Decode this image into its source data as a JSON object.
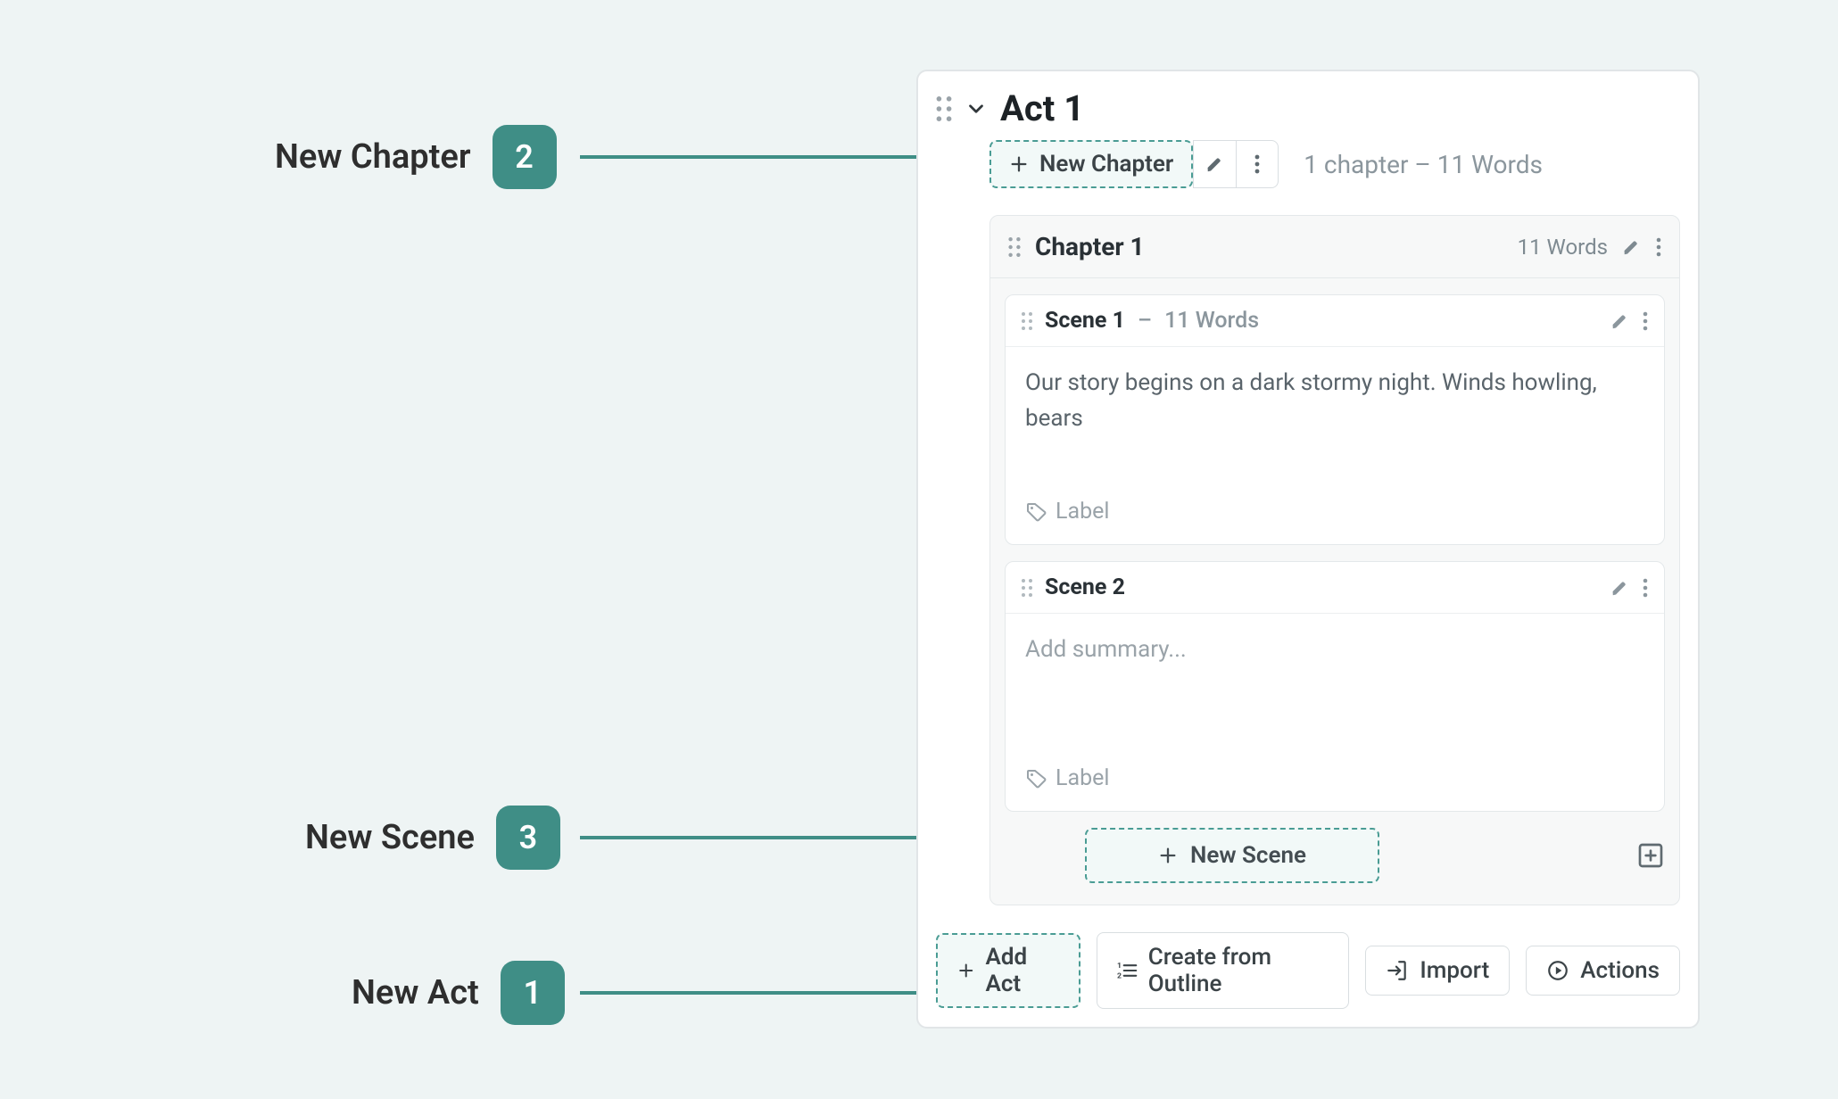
{
  "callouts": {
    "new_chapter": {
      "label": "New Chapter",
      "num": "2"
    },
    "new_scene": {
      "label": "New Scene",
      "num": "3"
    },
    "new_act": {
      "label": "New Act",
      "num": "1"
    }
  },
  "act": {
    "title": "Act 1",
    "new_chapter_btn": "New Chapter",
    "meta": "1 chapter   –   11 Words",
    "chapter": {
      "title": "Chapter 1",
      "words": "11 Words",
      "scenes": [
        {
          "title": "Scene 1",
          "sep": " – ",
          "words": "11 Words",
          "body": "Our story begins on a dark stormy night. Winds howling, bears",
          "label": "Label"
        },
        {
          "title": "Scene 2",
          "sep": "",
          "words": "",
          "body": "Add summary...",
          "placeholder": true,
          "label": "Label"
        }
      ],
      "new_scene_btn": "New Scene"
    }
  },
  "footer": {
    "add_act": "Add Act",
    "create_outline": "Create from Outline",
    "import": "Import",
    "actions": "Actions"
  }
}
